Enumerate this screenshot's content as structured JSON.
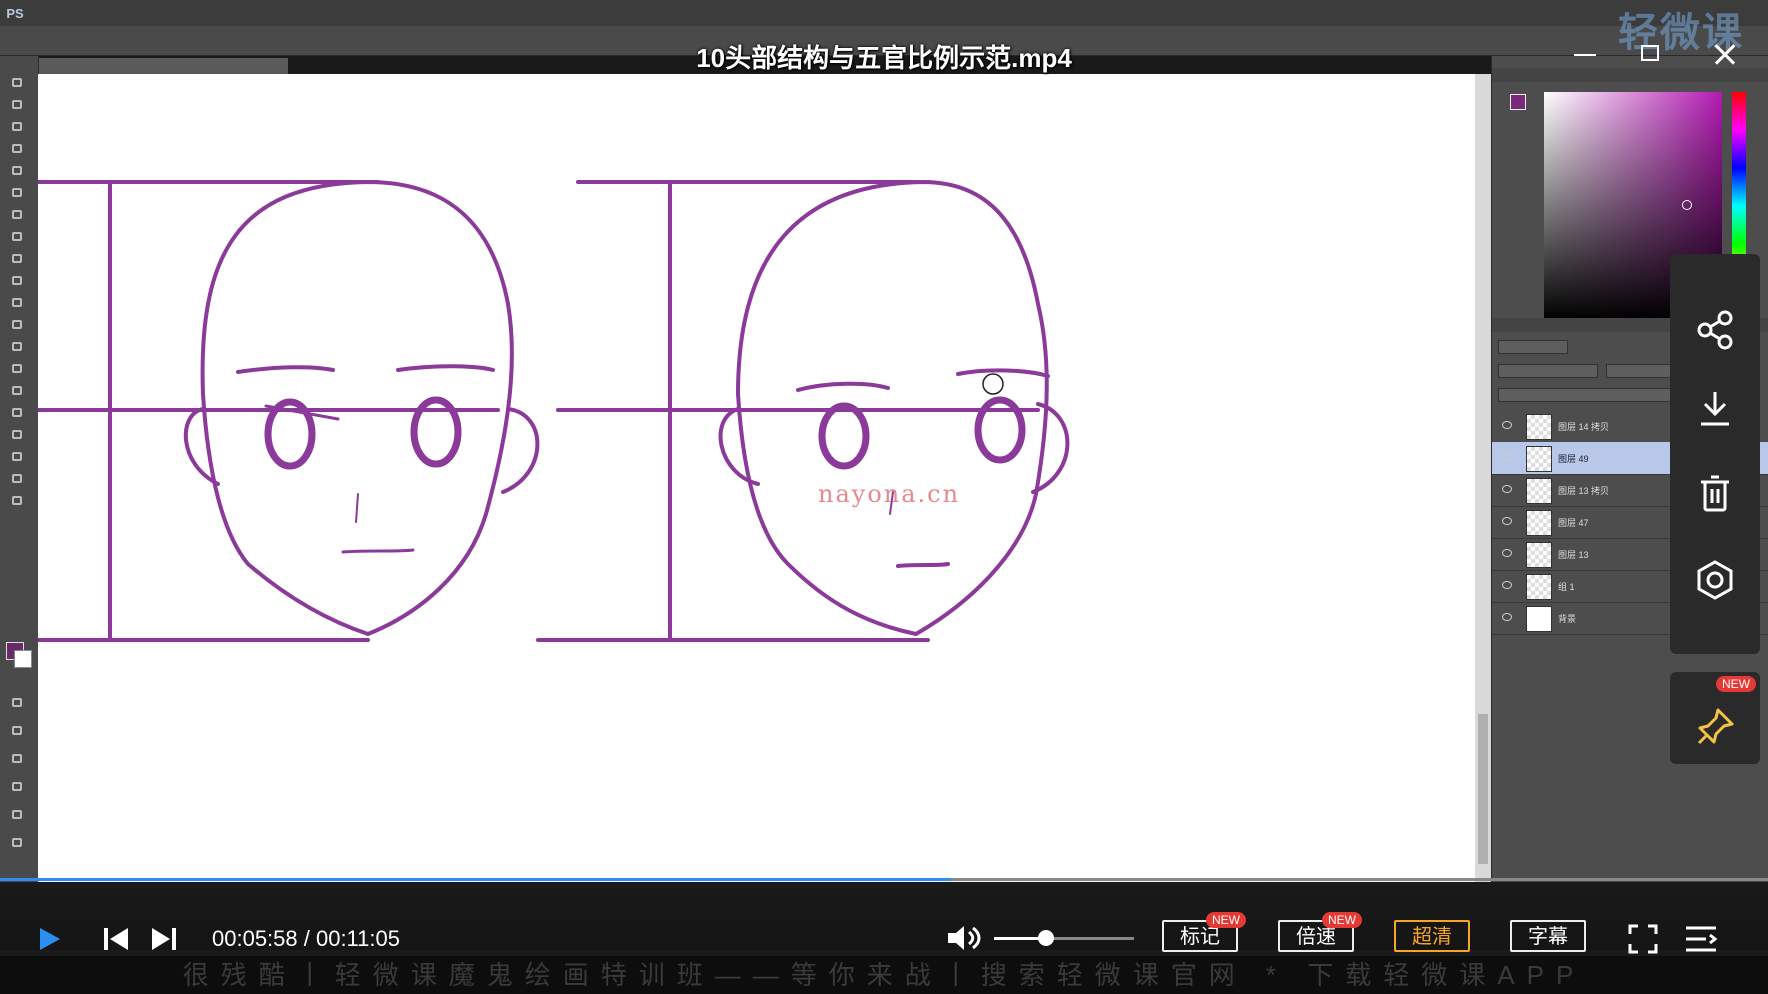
{
  "video": {
    "title": "10头部结构与五官比例示范.mp4",
    "current_time": "00:05:58",
    "total_time": "00:11:05",
    "time_display": "00:05:58 / 00:11:05",
    "progress_fraction": 0.538,
    "volume_fraction": 0.37,
    "accent_color": "#2a8ff0"
  },
  "controls": {
    "play_icon": "play-icon",
    "prev_icon": "previous-icon",
    "next_icon": "next-icon",
    "volume_icon": "volume-icon",
    "mark_label": "标记",
    "speed_label": "倍速",
    "quality_label": "超清",
    "subtitle_label": "字幕",
    "new_badge": "NEW",
    "fullscreen_icon": "fullscreen-icon",
    "playlist_icon": "playlist-icon"
  },
  "side_actions": [
    "share-icon",
    "download-icon",
    "delete-icon",
    "settings-icon",
    "pin-icon"
  ],
  "marquee": "很残酷丨轻微课魔鬼绘画特训班——等你来战丨搜索轻微课官网 * 下载轻微课APP",
  "watermark": "nayona.cn",
  "brand_logo": "轻微课",
  "photoshop": {
    "logo": "PS",
    "layers": [
      {
        "name": "图层 14 拷贝",
        "selected": false
      },
      {
        "name": "图层 49",
        "selected": true
      },
      {
        "name": "图层 13 拷贝",
        "selected": false
      },
      {
        "name": "图层 47",
        "selected": false
      },
      {
        "name": "图层 13",
        "selected": false
      },
      {
        "name": "组 1",
        "selected": false
      },
      {
        "name": "背景",
        "selected": false
      }
    ],
    "foreground_color": "#7a2a7a",
    "stroke_color": "#8b3a9a"
  }
}
